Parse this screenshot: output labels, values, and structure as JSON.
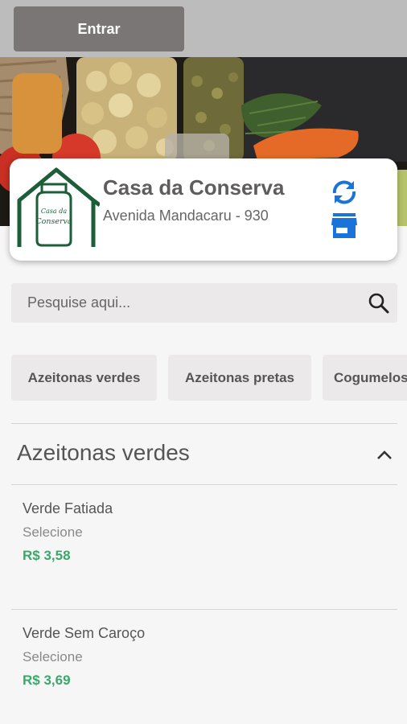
{
  "header": {
    "login_label": "Entrar"
  },
  "store": {
    "name": "Casa da Conserva",
    "address": "Avenida Mandacaru - 930",
    "logo_text_top": "Casa da",
    "logo_text_bottom": "Conserva",
    "icons": {
      "refresh": "sync-icon",
      "store": "storefront-icon"
    }
  },
  "search": {
    "placeholder": "Pesquise aqui...",
    "value": ""
  },
  "categories": [
    "Azeitonas verdes",
    "Azeitonas pretas",
    "Cogumelos"
  ],
  "section": {
    "title": "Azeitonas verdes",
    "expanded": true
  },
  "products": [
    {
      "name": "Verde Fatiada",
      "option": "Selecione",
      "price": "R$ 3,58"
    },
    {
      "name": "Verde Sem Caroço",
      "option": "Selecione",
      "price": "R$ 3,69"
    }
  ],
  "colors": {
    "accent_blue": "#1a73d9",
    "price_green": "#3aa76d",
    "logo_green": "#1b5e38",
    "topbar": "#bdbcbc",
    "button": "#7a7675"
  }
}
